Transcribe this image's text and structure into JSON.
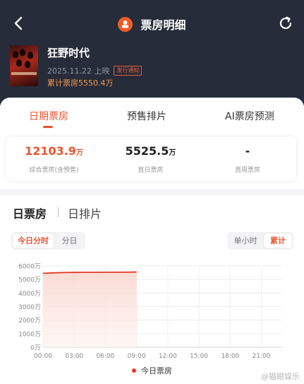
{
  "colors": {
    "header_bg": "#262c3a",
    "accent": "#e85532",
    "cumulative": "#f59a4d",
    "line": "#e03b24"
  },
  "nav": {
    "back_icon": "chevron-left-icon",
    "title": "票房明细",
    "logo_icon": "ticket-logo-icon",
    "refresh_icon": "refresh-icon"
  },
  "movie": {
    "title": "狂野时代",
    "release_date": "2025.11.22 上映",
    "release_badge": "发行通知",
    "cumulative": "累计票房5550.4万",
    "poster_text": "RESURRECTION"
  },
  "tabs": [
    {
      "label": "日期票房",
      "active": true
    },
    {
      "label": "预售排片",
      "active": false
    },
    {
      "label": "AI票房预测",
      "active": false
    }
  ],
  "stats": [
    {
      "value": "12103.9",
      "unit": "万",
      "label": "综合票房(含预售)"
    },
    {
      "value": "5525.5",
      "unit": "万",
      "label": "首日票房"
    },
    {
      "value": "-",
      "unit": "",
      "label": "首周票房"
    }
  ],
  "section_tabs": [
    {
      "label": "日票房",
      "active": true
    },
    {
      "label": "日排片",
      "active": false
    }
  ],
  "segments_left": [
    {
      "label": "今日分时",
      "active": true
    },
    {
      "label": "分日",
      "active": false
    }
  ],
  "segments_right": [
    {
      "label": "单小时",
      "active": false
    },
    {
      "label": "累计",
      "active": true
    }
  ],
  "chart_data": {
    "type": "area",
    "title": "",
    "xlabel": "",
    "ylabel": "",
    "x_ticks": [
      "00:00",
      "03:00",
      "06:00",
      "09:00",
      "12:00",
      "15:00",
      "18:00",
      "21:00"
    ],
    "y_ticks": [
      "0万",
      "1000万",
      "2000万",
      "3000万",
      "4000万",
      "5000万",
      "6000万"
    ],
    "ylim": [
      0,
      6000
    ],
    "xlim_hours": [
      0,
      23
    ],
    "grid": true,
    "legend_position": "bottom-center",
    "series": [
      {
        "name": "今日票房",
        "color": "#e03b24",
        "x_hours": [
          0,
          1,
          2,
          3,
          4,
          5,
          6,
          7,
          8,
          9
        ],
        "values": [
          5450,
          5490,
          5510,
          5520,
          5524,
          5526,
          5528,
          5531,
          5537,
          5548
        ]
      }
    ]
  },
  "watermark": "@猫眼娱乐"
}
